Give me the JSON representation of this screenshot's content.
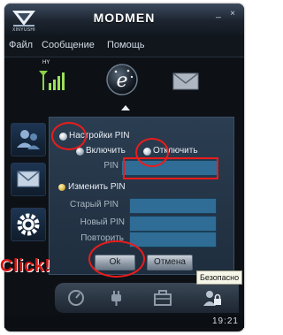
{
  "window": {
    "title": "MODMEN",
    "logo_text": "XINYUSHI",
    "controls": {
      "minimize": "_",
      "close": "×"
    }
  },
  "menubar": {
    "items": [
      "Файл",
      "Сообщение",
      "Помощь"
    ]
  },
  "toolbar": {
    "signal_label": "HY"
  },
  "icons": {
    "signal": "signal-bars-icon",
    "brand": "e-globe-icon",
    "mail": "envelope-icon",
    "side": [
      "users-icon",
      "mail-icon",
      "gear-icon"
    ],
    "bottom": [
      "speed-gauge-icon",
      "plug-icon",
      "toolbox-icon",
      "lock-user-icon"
    ]
  },
  "pin_settings": {
    "section_label": "Настройки PIN",
    "enable_label": "Включить",
    "disable_label": "Отключить",
    "selected": "disable",
    "pin_label": "PIN",
    "pin_value": "",
    "change_label": "Изменить PIN",
    "old_pin_label": "Старый PIN",
    "old_pin_value": "",
    "new_pin_label": "Новый PIN",
    "new_pin_value": "",
    "repeat_label": "Повторить",
    "repeat_value": "",
    "ok_label": "Ok",
    "cancel_label": "Отмена"
  },
  "tooltip": "Безопасно",
  "statusbar": {
    "time": "19:21"
  },
  "annotation": {
    "click_text": "Click!",
    "color": "#ea1c1c"
  },
  "colors": {
    "window_bg": "#0d1116",
    "field_bg": "#2f6d96",
    "panel_bg": "#2b3d51"
  }
}
